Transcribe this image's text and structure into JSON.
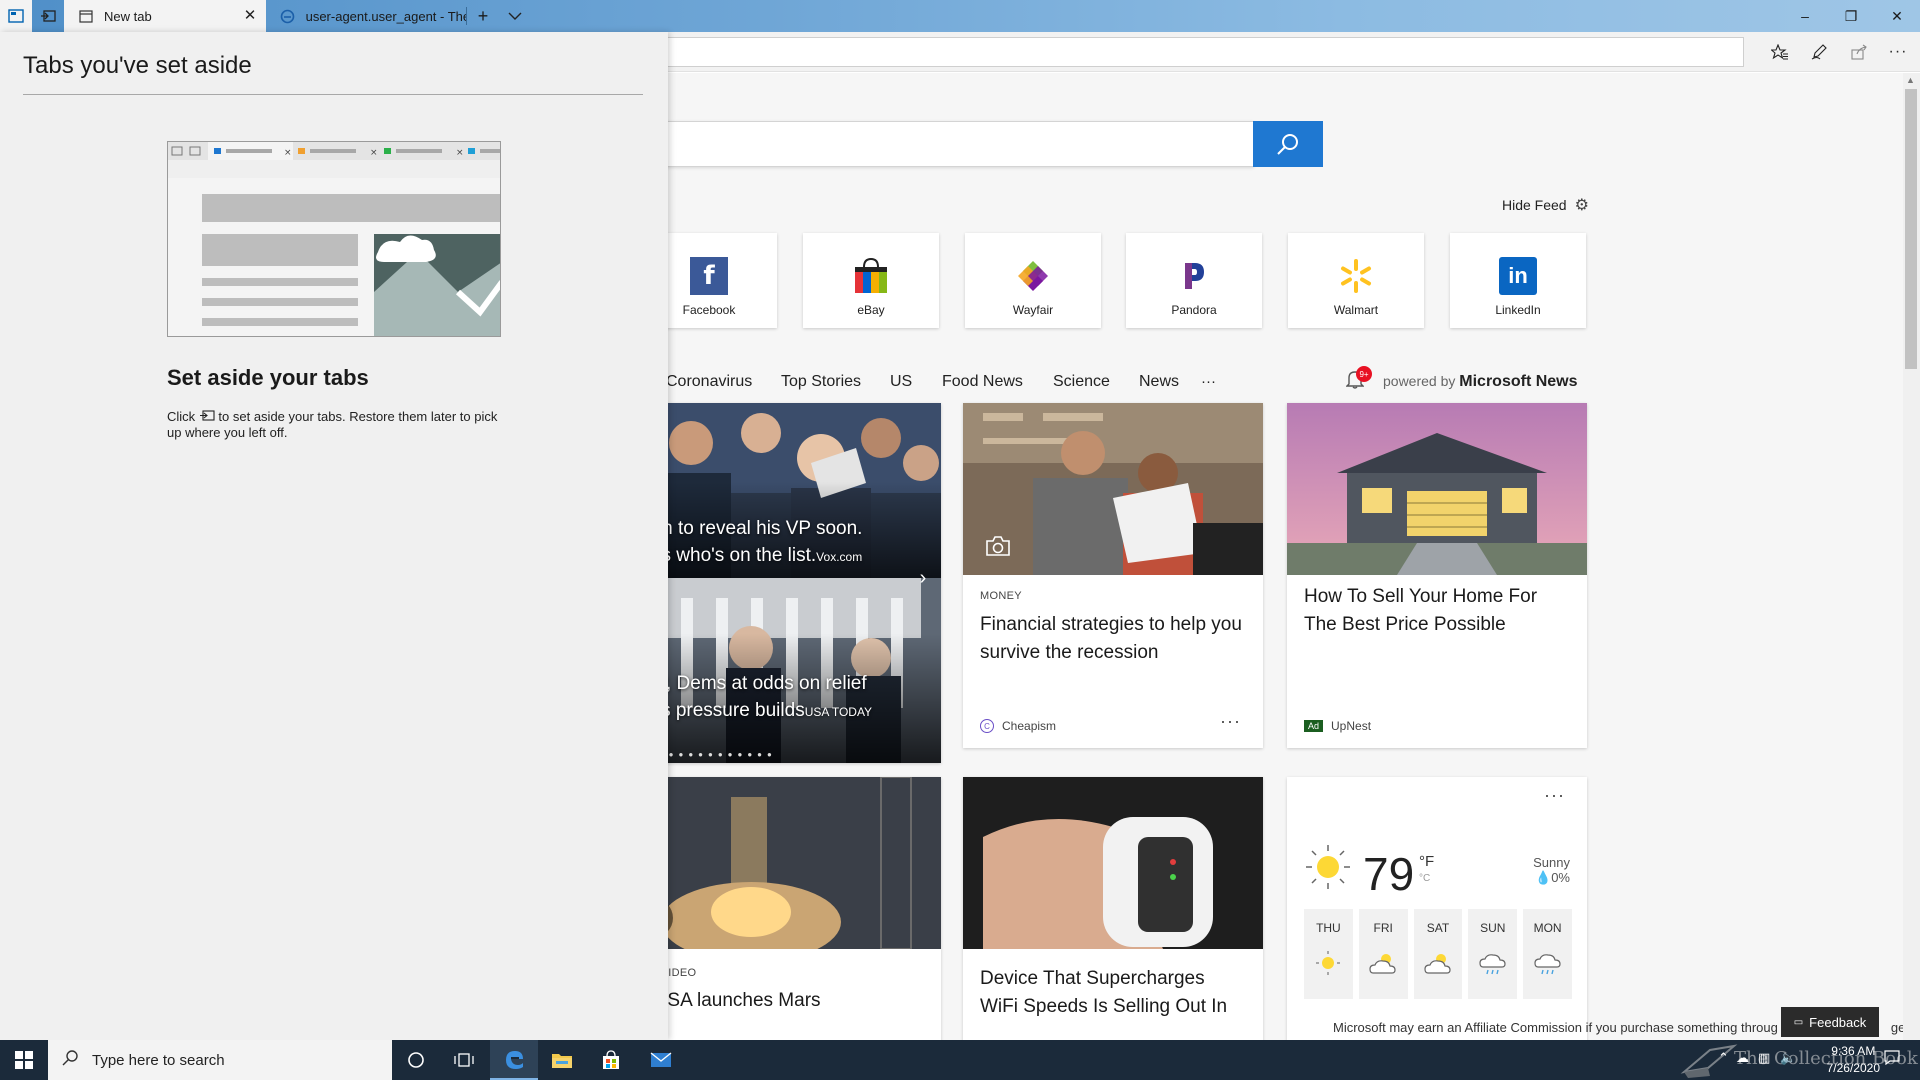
{
  "browser": {
    "tabs": [
      {
        "label": "New tab",
        "active": true
      },
      {
        "label": "user-agent.user_agent - The",
        "active": false
      }
    ],
    "new_tab_symbol": "+",
    "tab_list_symbol": "⌄",
    "window_controls": {
      "minimize": "–",
      "maximize": "❐",
      "close": "✕"
    },
    "toolbar_icons": [
      "favorites-icon",
      "pen-icon",
      "share-icon",
      "more-icon"
    ]
  },
  "set_aside_panel": {
    "title": "Tabs you've set aside",
    "subtitle": "Set aside your tabs",
    "description_before": "Click",
    "description_after": "to set aside your tabs. Restore them later to pick up where you left off."
  },
  "new_tab_page": {
    "hide_feed_label": "Hide Feed",
    "top_sites": [
      {
        "name": "Facebook",
        "icon": "facebook-logo",
        "color": "#3b5998"
      },
      {
        "name": "eBay",
        "icon": "ebay-bag-logo",
        "color": "#e53238"
      },
      {
        "name": "Wayfair",
        "icon": "wayfair-logo",
        "color": "#7b189f"
      },
      {
        "name": "Pandora",
        "icon": "pandora-logo",
        "color": "#224099"
      },
      {
        "name": "Walmart",
        "icon": "walmart-spark-logo",
        "color": "#ffc220"
      },
      {
        "name": "LinkedIn",
        "icon": "linkedin-logo",
        "color": "#0a66c2"
      }
    ],
    "categories": [
      "Coronavirus",
      "Top Stories",
      "US",
      "Food News",
      "Science",
      "News",
      "···"
    ],
    "notification_badge": "9+",
    "powered_by_prefix": "powered by",
    "powered_by_brand": "Microsoft News",
    "carousel": {
      "slide1_line1": "den to reveal his VP soon.",
      "slide1_line2": "re's who's on the list.",
      "slide1_source": "Vox.com",
      "slide2_line1": "OP, Dems at odds on relief",
      "slide2_line2": "l as pressure builds",
      "slide2_source": "USA TODAY"
    },
    "cards": [
      {
        "kicker": "MONEY",
        "headline": "Financial strategies to help you survive the recession",
        "source": "Cheapism",
        "more": "···"
      },
      {
        "headline": "How To Sell Your Home For The Best Price Possible",
        "ad_label": "Ad",
        "source": "UpNest"
      },
      {
        "kicker": "OP VIDEO",
        "headline": "NASA launches Mars"
      },
      {
        "headline": "Device That Supercharges WiFi Speeds Is Selling Out In"
      }
    ],
    "weather": {
      "temperature": "79",
      "unit_f": "°F",
      "unit_c": "°C",
      "condition": "Sunny",
      "precip": "0%",
      "more": "···",
      "forecast": [
        {
          "day": "THU",
          "icon": "sun-icon"
        },
        {
          "day": "FRI",
          "icon": "partly-cloudy-icon"
        },
        {
          "day": "SAT",
          "icon": "partly-cloudy-icon"
        },
        {
          "day": "SUN",
          "icon": "rain-cloud-icon"
        },
        {
          "day": "MON",
          "icon": "rain-cloud-icon"
        }
      ]
    },
    "disclaimer": "Microsoft may earn an Affiliate Commission if you purchase something throug",
    "disclaimer_tail": "ge.",
    "feedback_label": "Feedback"
  },
  "taskbar": {
    "search_placeholder": "Type here to search",
    "time": "9:36 AM",
    "date": "7/26/2020",
    "watermark": "The Collection Book"
  },
  "colors": {
    "accent": "#1f78d1",
    "titlebar": "#6fa6d6",
    "taskbar": "#1b2a3a"
  }
}
